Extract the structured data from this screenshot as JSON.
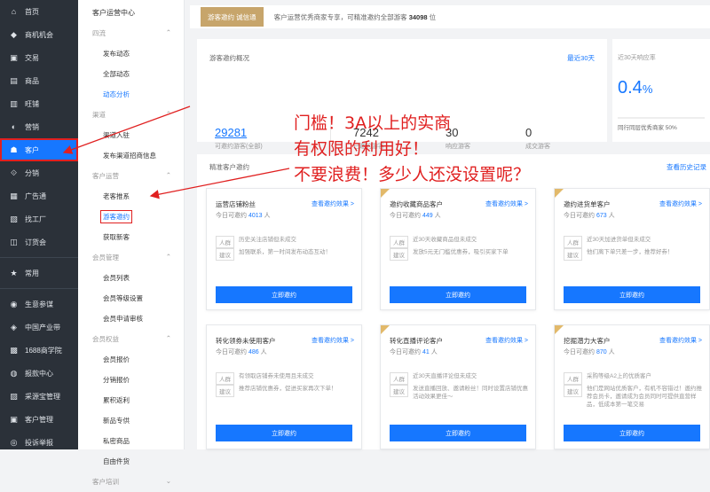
{
  "sidebar": {
    "items": [
      {
        "icon": "home-icon",
        "glyph": "⌂",
        "label": "首页"
      },
      {
        "icon": "opportunity-icon",
        "glyph": "◆",
        "label": "商机机会"
      },
      {
        "icon": "trade-icon",
        "glyph": "▣",
        "label": "交易"
      },
      {
        "icon": "product-icon",
        "glyph": "▤",
        "label": "商品"
      },
      {
        "icon": "shop-icon",
        "glyph": "▥",
        "label": "旺铺"
      },
      {
        "icon": "marketing-icon",
        "glyph": "◐",
        "label": "营销"
      },
      {
        "icon": "customer-icon",
        "glyph": "☗",
        "label": "客户"
      },
      {
        "icon": "distribution-icon",
        "glyph": "⟐",
        "label": "分销"
      },
      {
        "icon": "ad-icon",
        "glyph": "▦",
        "label": "广告通"
      },
      {
        "icon": "factory-icon",
        "glyph": "▧",
        "label": "找工厂"
      },
      {
        "icon": "order-icon",
        "glyph": "◫",
        "label": "订货会"
      }
    ],
    "common": {
      "icon": "star-icon",
      "glyph": "★",
      "label": "常用"
    },
    "tools": [
      {
        "icon": "business-icon",
        "glyph": "◉",
        "label": "生意参谋"
      },
      {
        "icon": "industry-icon",
        "glyph": "◈",
        "label": "中国产业带"
      },
      {
        "icon": "school-icon",
        "glyph": "▩",
        "label": "1688商学院"
      },
      {
        "icon": "report-icon",
        "glyph": "◍",
        "label": "报款中心"
      },
      {
        "icon": "purchase-icon",
        "glyph": "▨",
        "label": "采源宝管理"
      },
      {
        "icon": "crm-icon",
        "glyph": "▣",
        "label": "客户管理"
      },
      {
        "icon": "complaint-icon",
        "glyph": "◎",
        "label": "投诉举报"
      }
    ],
    "colors": {
      "accent": "#1677ff",
      "bg": "#2b3139"
    }
  },
  "submenu": {
    "header": "客户运营中心",
    "groups": [
      {
        "title": "四流",
        "items": [
          "发布动态",
          "全部动态",
          "动态分析"
        ]
      },
      {
        "title": "渠道",
        "items": [
          "渠道入驻",
          "发布渠道招商信息"
        ]
      },
      {
        "title": "客户运营",
        "items": [
          "老客推系",
          "游客邀约",
          "获取新客"
        ]
      },
      {
        "title": "会员管理",
        "items": [
          "会员列表",
          "会员等级设置",
          "会员申请审核"
        ]
      },
      {
        "title": "会员权益",
        "items": [
          "会员报价",
          "分销报价",
          "累积返利",
          "新品专供",
          "私密商品",
          "自由件货"
        ]
      },
      {
        "title": "客户培训",
        "items": []
      }
    ]
  },
  "topbar": {
    "badge": "游客邀约 诚信通",
    "text": "客户运营优秀商家专享，可精准邀约全部游客",
    "count": "34098",
    "suffix": "位"
  },
  "overview": {
    "title": "游客邀约概况",
    "link": "最近30天",
    "stats": [
      {
        "value": "29281",
        "label": "可邀约游客(全部)"
      },
      {
        "value": "7242",
        "label": "已邀约游客"
      },
      {
        "value": "30",
        "label": "响应游客"
      },
      {
        "value": "0",
        "label": "成交游客"
      }
    ]
  },
  "rate": {
    "title": "近30天响应率",
    "value": "0.4",
    "unit": "%",
    "footer": "同行同层优秀商家 50%"
  },
  "precise": {
    "title": "精准客户邀约",
    "link": "查看历史记录"
  },
  "cards": [
    {
      "title": "运营店铺粉丝",
      "count_prefix": "今日可邀约",
      "count": "4013",
      "count_suffix": "人",
      "link": "查看邀约效果 >",
      "tag1": "人群",
      "text1": "历史关注店铺但未成交",
      "tag2": "建议",
      "text2": "加强联系，第一时间发布动态互动！",
      "button": "立即邀约"
    },
    {
      "title": "邀约收藏商品客户",
      "count_prefix": "今日可邀约",
      "count": "449",
      "count_suffix": "人",
      "link": "查看邀约效果 >",
      "tag1": "人群",
      "text1": "近30天收藏商品但未成交",
      "tag2": "建议",
      "text2": "发放5元无门槛优惠券，吸引买家下单",
      "button": "立即邀约"
    },
    {
      "title": "邀约进货单客户",
      "count_prefix": "今日可邀约",
      "count": "673",
      "count_suffix": "人",
      "link": "查看邀约效果 >",
      "tag1": "人群",
      "text1": "近30天加进货单但未成交",
      "tag2": "建议",
      "text2": "他们离下单只差一步，推荐好券！",
      "button": "立即邀约"
    },
    {
      "title": "转化领券未使用客户",
      "count_prefix": "今日可邀约",
      "count": "486",
      "count_suffix": "人",
      "link": "查看邀约效果 >",
      "tag1": "人群",
      "text1": "有领取店铺券未使用且未成交",
      "tag2": "建议",
      "text2": "推荐店铺优惠券，促进买家再次下单！",
      "button": "立即邀约"
    },
    {
      "title": "转化直播评论客户",
      "count_prefix": "今日可邀约",
      "count": "41",
      "count_suffix": "人",
      "link": "查看邀约效果 >",
      "tag1": "人群",
      "text1": "近30天直播评论但未成交",
      "tag2": "建议",
      "text2": "发送直播回放、邀请粉丝！同时设置店铺优惠活动效果更佳～",
      "button": "立即邀约"
    },
    {
      "title": "挖掘潜力大客户",
      "count_prefix": "今日可邀约",
      "count": "870",
      "count_suffix": "人",
      "link": "查看邀约效果 >",
      "tag1": "人群",
      "text1": "采购等级A2上的优质客户",
      "tag2": "建议",
      "text2": "他们是网站优质客户，有机不容错过！邀约推荐会员卡，邀请成为会员同时可提供直营样品，低成本第一笔交易",
      "button": "立即邀约"
    }
  ],
  "annotation": {
    "lines": [
      "门槛！3A以上的实商",
      "有权限的利用好！",
      "不要浪费！多少人还没设置呢？"
    ],
    "color": "#e02020"
  }
}
